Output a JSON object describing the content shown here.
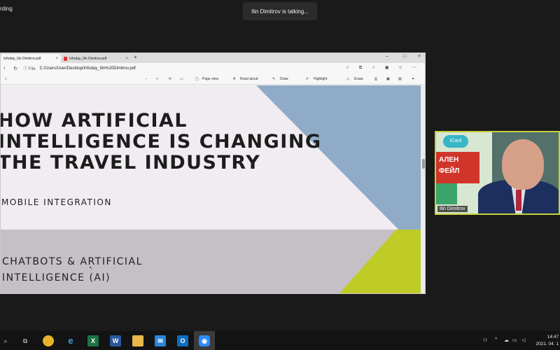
{
  "zoom": {
    "recording_label": "rding",
    "talking_indicator": "Ilin Dimitrov is talking..."
  },
  "browser": {
    "tabs": [
      {
        "label": "Infoday_Ilin Dimitrov.pdf",
        "active": true
      },
      {
        "label": "Infoday_Ilin Dimitrov.pdf",
        "active": false
      }
    ],
    "new_tab": "+",
    "address_prefix": "File",
    "url": "C:/Users/User/Desktop/Infoday_Ilin%20Dimitrov.pdf",
    "pdf_toolbar": {
      "zoom_out": "−",
      "zoom_in": "+",
      "page_view": "Page view",
      "read_aloud": "Read aloud",
      "draw": "Draw",
      "highlight": "Highlight",
      "erase": "Erase"
    }
  },
  "slide": {
    "title_lines": [
      "HOW ARTIFICIAL",
      "INTELLIGENCE IS CHANGING",
      "THE TRAVEL INDUSTRY"
    ],
    "bullet1": "MOBILE INTEGRATION",
    "bullet2_lines": [
      "CHATBOTS & ARTIFICIAL",
      "INTELLIGENCE (AI)"
    ]
  },
  "colors": {
    "slide_bg": "#f1ecf1",
    "triangle_blue": "#8fabc8",
    "band_grey": "#c4c0c5",
    "triangle_lime": "#bfcb27",
    "video_border": "#c5d13a"
  },
  "participant": {
    "name": "Ilin Dimitrov",
    "banner_logo": "iCard",
    "banner_lines": [
      "АЛЕН",
      "ФЕЙЛ"
    ]
  },
  "taskbar": {
    "apps": [
      "search-icon",
      "taskview-icon",
      "chrome-icon",
      "edge-icon",
      "excel-icon",
      "word-icon",
      "explorer-icon",
      "mail-icon",
      "outlook-icon",
      "zoom-icon"
    ],
    "time": "14:47",
    "date": "2021. 04. 1"
  }
}
